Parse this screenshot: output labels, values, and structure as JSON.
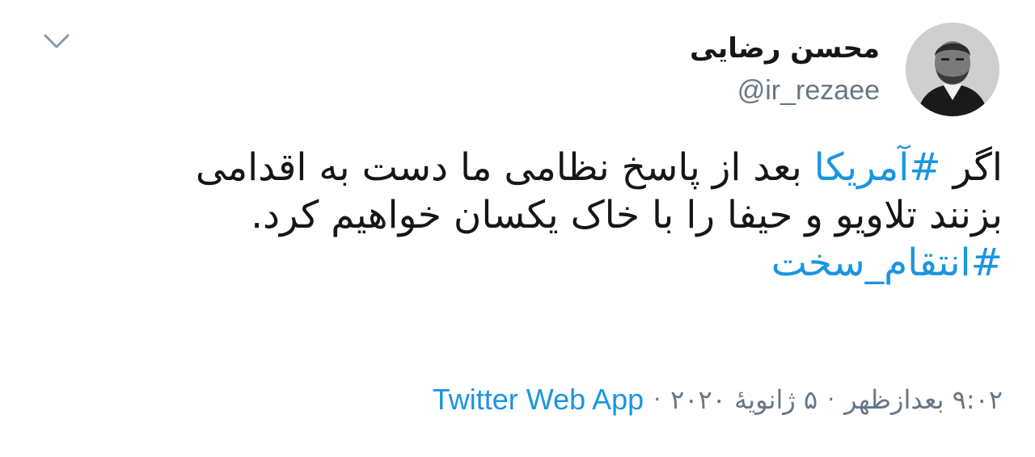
{
  "author": {
    "display_name": "محسن رضایی",
    "handle": "@ir_rezaee",
    "avatar_icon": "profile-photo"
  },
  "menu": {
    "icon": "chevron-down-icon"
  },
  "tweet": {
    "line1_prefix": "اگر ",
    "line1_hashtag": "#آمریکا",
    "line1_suffix": " بعد از پاسخ نظامی ما دست به اقدامی",
    "line2": "بزنند تلاویو و حیفا را با خاک یکسان خواهیم کرد.",
    "line3_hashtag": "#انتقام_سخت"
  },
  "meta": {
    "time": "۹:۰۲ بعدازظهر",
    "date": "۵ ژانویهٔ ۲۰۲۰",
    "separator": "·",
    "source": "Twitter Web App"
  },
  "colors": {
    "link": "#1b95e0",
    "secondary_text": "#657786",
    "primary_text": "#14171a",
    "background": "#ffffff"
  }
}
